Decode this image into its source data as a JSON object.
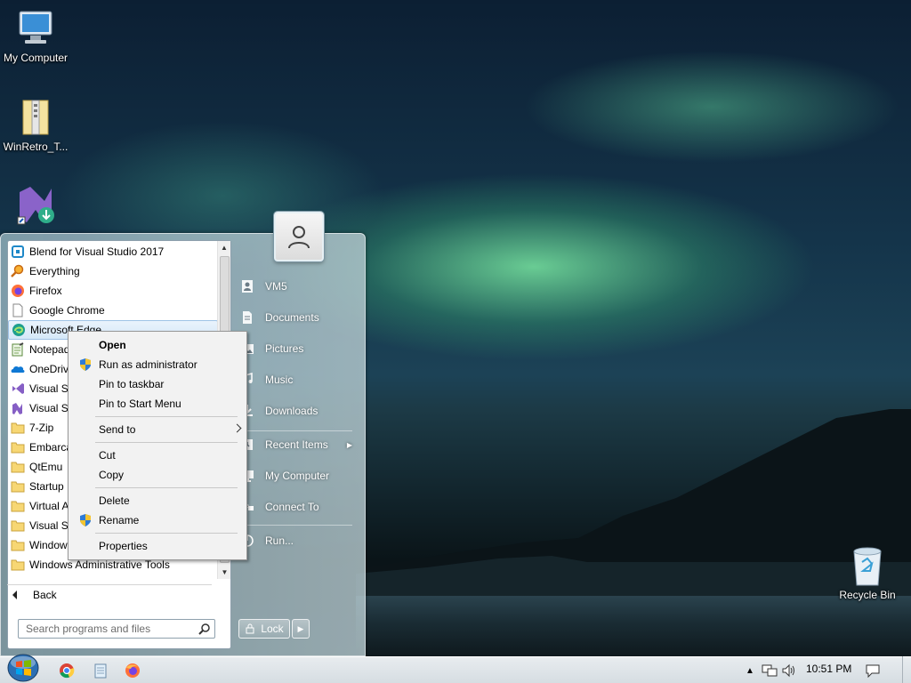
{
  "desktop": {
    "icons": [
      {
        "label": "My Computer",
        "icon": "computer-icon"
      },
      {
        "label": "WinRetro_T...",
        "icon": "folder-zip-icon"
      },
      {
        "label": "",
        "icon": "visual-studio-installer-icon"
      },
      {
        "label": "Recycle Bin",
        "icon": "recycle-bin-icon"
      }
    ]
  },
  "start_menu": {
    "programs": [
      {
        "label": "Blend for Visual Studio 2017",
        "icon": "blend-icon",
        "color": "#1e88c8"
      },
      {
        "label": "Everything",
        "icon": "search-magnifier-icon",
        "color": "#e07820"
      },
      {
        "label": "Firefox",
        "icon": "firefox-icon",
        "color": "#e66000"
      },
      {
        "label": "Google Chrome",
        "icon": "blank-file-icon",
        "color": "#888888"
      },
      {
        "label": "Microsoft Edge",
        "icon": "edge-icon",
        "color": "#1a8a9c"
      },
      {
        "label": "Notepad",
        "icon": "notepad-icon",
        "color": "#6aa84f"
      },
      {
        "label": "OneDrive",
        "icon": "onedrive-icon",
        "color": "#0f78d4"
      },
      {
        "label": "Visual St",
        "icon": "visual-studio-icon",
        "color": "#865fc5"
      },
      {
        "label": "Visual St",
        "icon": "visual-studio-installer-icon",
        "color": "#865fc5"
      },
      {
        "label": "7-Zip",
        "icon": "folder-icon",
        "color": "#f2c94c"
      },
      {
        "label": "Embarca",
        "icon": "folder-icon",
        "color": "#f2c94c"
      },
      {
        "label": "QtEmu",
        "icon": "folder-icon",
        "color": "#f2c94c"
      },
      {
        "label": "Startup",
        "icon": "folder-icon",
        "color": "#f2c94c"
      },
      {
        "label": "Virtual A",
        "icon": "folder-icon",
        "color": "#f2c94c"
      },
      {
        "label": "Visual St",
        "icon": "folder-icon",
        "color": "#f2c94c"
      },
      {
        "label": "Window",
        "icon": "folder-icon",
        "color": "#f2c94c"
      },
      {
        "label": "Windows Administrative Tools",
        "icon": "folder-icon",
        "color": "#f2c94c"
      }
    ],
    "selected_index": 4,
    "back_label": "Back",
    "search_placeholder": "Search programs and files",
    "right_items": [
      {
        "label": "VM5",
        "icon": "user-folder-icon"
      },
      {
        "label": "Documents",
        "icon": "documents-icon"
      },
      {
        "label": "Pictures",
        "icon": "pictures-icon"
      },
      {
        "label": "Music",
        "icon": "music-icon"
      },
      {
        "label": "Downloads",
        "icon": "downloads-icon"
      },
      {
        "label": "Recent Items",
        "icon": "recent-items-icon",
        "has_submenu": true
      },
      {
        "label": "My Computer",
        "icon": "computer-icon"
      },
      {
        "label": "Connect To",
        "icon": "connect-to-icon"
      },
      {
        "label": "Run...",
        "icon": "run-icon"
      }
    ],
    "lock_label": "Lock"
  },
  "context_menu": {
    "items": [
      {
        "label": "Open",
        "bold": true
      },
      {
        "label": "Run as administrator",
        "icon": "uac-shield-icon"
      },
      {
        "label": "Pin to taskbar"
      },
      {
        "label": "Pin to Start Menu"
      },
      {
        "label": "Send to",
        "has_submenu": true
      },
      {
        "label": "Cut"
      },
      {
        "label": "Copy"
      },
      {
        "label": "Delete"
      },
      {
        "label": "Rename",
        "icon": "uac-shield-icon"
      },
      {
        "label": "Properties"
      }
    ]
  },
  "taskbar": {
    "pinned": [
      "chrome-icon",
      "notepad-icon",
      "firefox-icon"
    ],
    "tray": {
      "time": "10:51 PM"
    }
  },
  "colors": {
    "selection": "#d5e8f8",
    "menu_bg": "#f2f2f2",
    "taskbar": "#dfe4e8"
  }
}
